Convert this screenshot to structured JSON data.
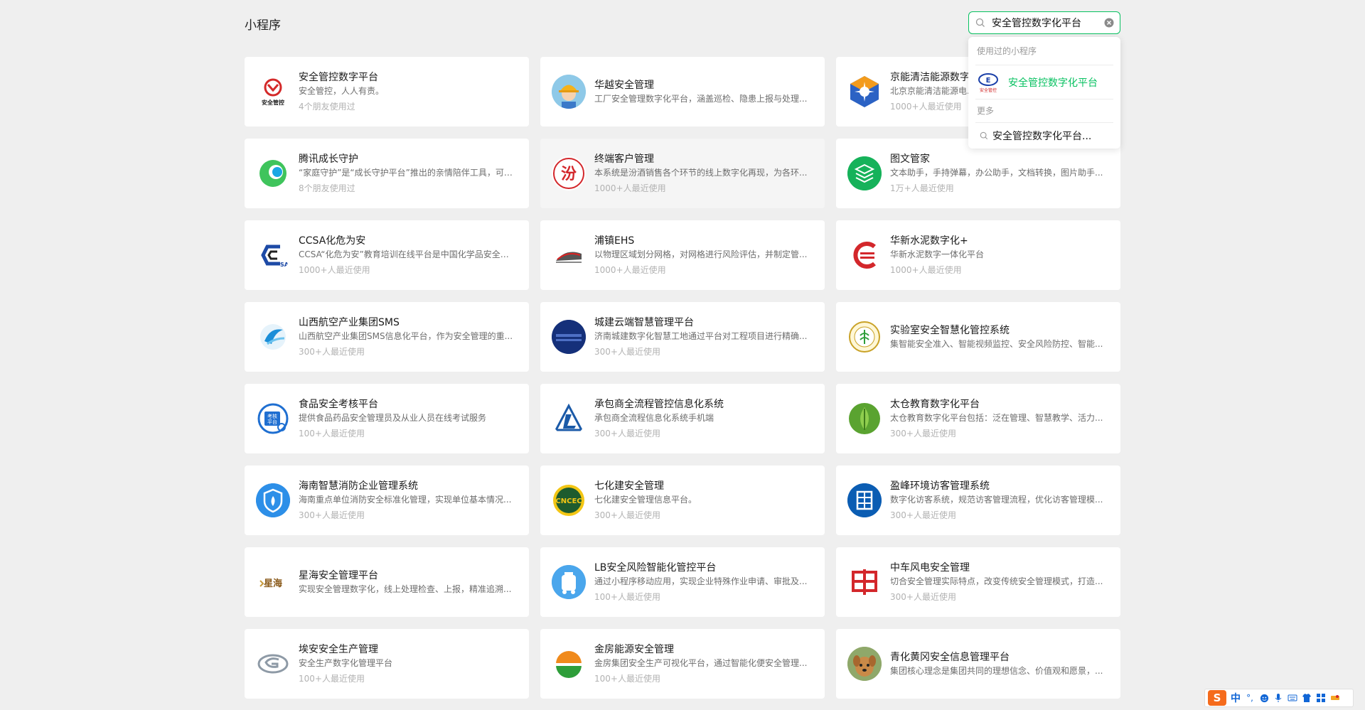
{
  "header": {
    "title": "小程序"
  },
  "search": {
    "value": "安全管控数字化平台"
  },
  "dropdown": {
    "recent_header": "使用过的小程序",
    "recent_item": "安全管控数字化平台",
    "more_header": "更多",
    "suggestion": "安全管控数字化平台..."
  },
  "cards": [
    {
      "name": "安全管控数字平台",
      "desc": "安全管控，人人有责。",
      "usage": "4个朋友使用过",
      "logo": "safety-shield-logo"
    },
    {
      "name": "华越安全管理",
      "desc": "工厂安全管理数字化平台，涵盖巡检、隐患上报与处理...",
      "usage": "",
      "logo": "worker-helmet-logo"
    },
    {
      "name": "京能清洁能源数字...",
      "desc": "北京京能清洁能源电...",
      "usage": "1000+人最近使用",
      "logo": "star-cube-logo"
    },
    {
      "name": "腾讯成长守护",
      "desc": "“家庭守护”是“成长守护平台”推出的亲情陪伴工具，可以...",
      "usage": "8个朋友使用过",
      "logo": "growth-guard-logo"
    },
    {
      "name": "终端客户管理",
      "desc": "本系统是汾酒销售各个环节的线上数字化再现，为各环...",
      "usage": "1000+人最近使用",
      "logo": "fen-liquor-logo"
    },
    {
      "name": "图文管家",
      "desc": "文本助手，手持弹幕，办公助手，文档转换，图片助手...",
      "usage": "1万+人最近使用",
      "logo": "layers-logo"
    },
    {
      "name": "CCSA化危为安",
      "desc": "CCSA“化危为安”教育培训在线平台是中国化学品安全协...",
      "usage": "1000+人最近使用",
      "logo": "ccsa-logo"
    },
    {
      "name": "浦镇EHS",
      "desc": "以物理区域划分网格，对网格进行风险评估，并制定管...",
      "usage": "1000+人最近使用",
      "logo": "train-logo"
    },
    {
      "name": "华新水泥数字化+",
      "desc": "华新水泥数字一体化平台",
      "usage": "1000+人最近使用",
      "logo": "huaxin-logo"
    },
    {
      "name": "山西航空产业集团SMS",
      "desc": "山西航空产业集团SMS信息化平台，作为安全管理的重...",
      "usage": "300+人最近使用",
      "logo": "aviation-logo"
    },
    {
      "name": "城建云端智慧管理平台",
      "desc": "济南城建数字化智慧工地通过平台对工程项目进行精确...",
      "usage": "300+人最近使用",
      "logo": "city-build-logo"
    },
    {
      "name": "实验室安全智慧化管控系统",
      "desc": "集智能安全准入、智能视频监控、安全风险防控、智能...",
      "usage": "",
      "logo": "lab-emblem-logo"
    },
    {
      "name": "食品安全考核平台",
      "desc": "提供食品药品安全管理员及从业人员在线考试服务",
      "usage": "100+人最近使用",
      "logo": "exam-platform-logo"
    },
    {
      "name": "承包商全流程管控信息化系统",
      "desc": "承包商全流程信息化系统手机端",
      "usage": "300+人最近使用",
      "logo": "linali-logo"
    },
    {
      "name": "太仓教育数字化平台",
      "desc": "太仓教育数字化平台包括：泛在管理、智慧教学、活力...",
      "usage": "300+人最近使用",
      "logo": "leaf-logo"
    },
    {
      "name": "海南智慧消防企业管理系统",
      "desc": "海南重点单位消防安全标准化管理，实现单位基本情况...",
      "usage": "300+人最近使用",
      "logo": "fire-shield-logo"
    },
    {
      "name": "七化建安全管理",
      "desc": "七化建安全管理信息平台。",
      "usage": "300+人最近使用",
      "logo": "cncec-logo"
    },
    {
      "name": "盈峰环境访客管理系统",
      "desc": "数字化访客系统，规范访客管理流程，优化访客管理模...",
      "usage": "300+人最近使用",
      "logo": "yingfeng-logo"
    },
    {
      "name": "星海安全管理平台",
      "desc": "实现安全管理数字化，线上处理检查、上报，精准追溯...",
      "usage": "",
      "logo": "xinghai-logo"
    },
    {
      "name": "LB安全风险智能化管控平台",
      "desc": "通过小程序移动应用，实现企业特殊作业申请、审批及...",
      "usage": "100+人最近使用",
      "logo": "tank-logo"
    },
    {
      "name": "中车风电安全管理",
      "desc": "切合安全管理实际特点，改变传统安全管理模式，打造...",
      "usage": "300+人最近使用",
      "logo": "crrc-logo"
    },
    {
      "name": "埃安安全生产管理",
      "desc": "安全生产数字化管理平台",
      "usage": "100+人最近使用",
      "logo": "gac-logo"
    },
    {
      "name": "金房能源安全管理",
      "desc": "金房集团安全生产可视化平台，通过智能化便安全管理...",
      "usage": "100+人最近使用",
      "logo": "jinfang-logo"
    },
    {
      "name": "青化黄冈安全信息管理平台",
      "desc": "集团核心理念是集团共同的理想信念、价值观和愿景，...",
      "usage": "",
      "logo": "dog-photo-logo"
    }
  ],
  "ime": {
    "mode": "中",
    "logo": "S"
  }
}
